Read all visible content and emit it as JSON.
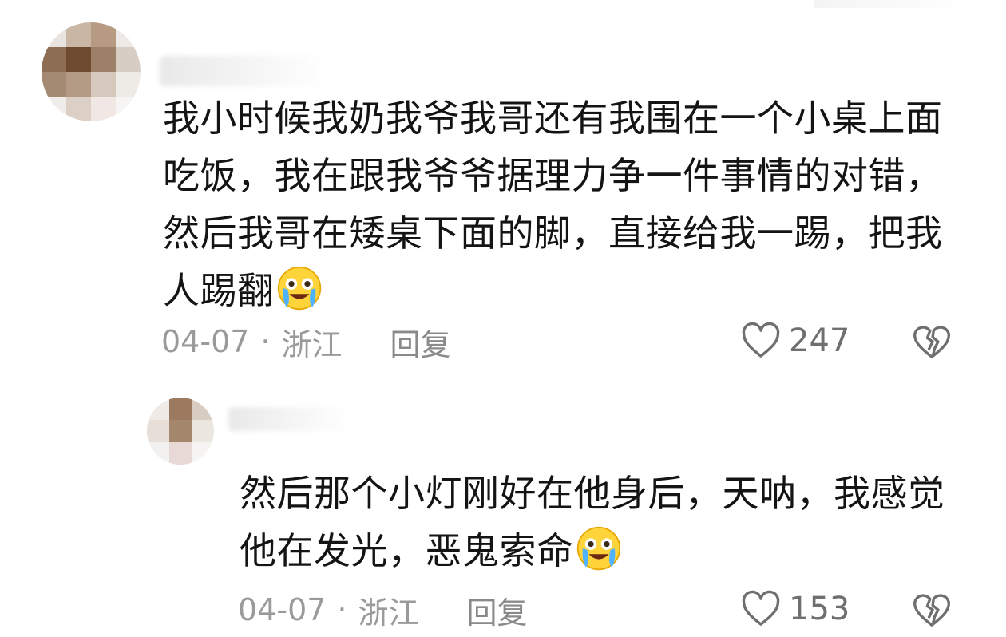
{
  "comments": [
    {
      "text": "我小时候我奶我爷我哥还有我围在一个小桌上面吃饭，我在跟我爷爷据理力争一件事情的对错，然后我哥在矮桌下面的脚，直接给我一踢，把我人踢翻",
      "emoji": "crying-laughing-emoji",
      "date": "04-07",
      "separator": "·",
      "location": "浙江",
      "reply_label": "回复",
      "likes": "247"
    },
    {
      "text": "然后那个小灯刚好在他身后，天呐，我感觉他在发光，恶鬼索命",
      "emoji": "crying-laughing-emoji",
      "date": "04-07",
      "separator": "·",
      "location": "浙江",
      "reply_label": "回复",
      "likes": "153"
    }
  ],
  "icons": {
    "like": "heart-outline-icon",
    "dislike": "broken-heart-icon"
  },
  "colors": {
    "text": "#141414",
    "meta": "#9a9a9a",
    "icon": "#6f6f6f"
  }
}
